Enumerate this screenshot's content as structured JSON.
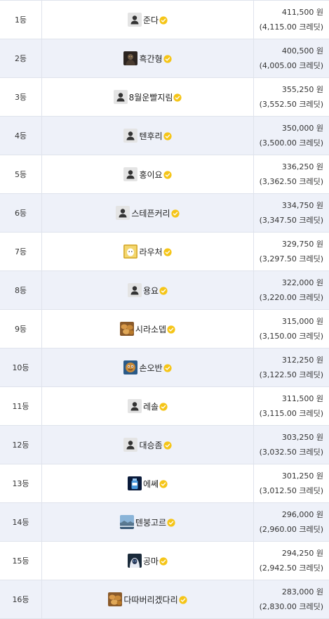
{
  "ranking": [
    {
      "rank": "1등",
      "name": "준다",
      "avatar": "default-user-icon",
      "amount": "411,500 원",
      "credits": "(4,115.00 크레딧)"
    },
    {
      "rank": "2등",
      "name": "흑간형",
      "avatar": "dark-character-avatar",
      "amount": "400,500 원",
      "credits": "(4,005.00 크레딧)"
    },
    {
      "rank": "3등",
      "name": "8월운빨지림",
      "avatar": "default-user-icon",
      "amount": "355,250 원",
      "credits": "(3,552.50 크레딧)"
    },
    {
      "rank": "4등",
      "name": "텐후리",
      "avatar": "default-user-icon",
      "amount": "350,000 원",
      "credits": "(3,500.00 크레딧)"
    },
    {
      "rank": "5등",
      "name": "홍이요",
      "avatar": "default-user-icon",
      "amount": "336,250 원",
      "credits": "(3,362.50 크레딧)"
    },
    {
      "rank": "6등",
      "name": "스테픈커리",
      "avatar": "default-user-icon",
      "amount": "334,750 원",
      "credits": "(3,347.50 크레딧)"
    },
    {
      "rank": "7등",
      "name": "라우처",
      "avatar": "yellow-ghost-avatar",
      "amount": "329,750 원",
      "credits": "(3,297.50 크레딧)"
    },
    {
      "rank": "8등",
      "name": "용요",
      "avatar": "default-user-icon",
      "amount": "322,000 원",
      "credits": "(3,220.00 크레딧)"
    },
    {
      "rank": "9등",
      "name": "시라소뎁",
      "avatar": "bread-avatar",
      "amount": "315,000 원",
      "credits": "(3,150.00 크레딧)"
    },
    {
      "rank": "10등",
      "name": "손오반",
      "avatar": "cookie-face-avatar",
      "amount": "312,250 원",
      "credits": "(3,122.50 크레딧)"
    },
    {
      "rank": "11등",
      "name": "레솔",
      "avatar": "default-user-icon",
      "amount": "311,500 원",
      "credits": "(3,115.00 크레딧)"
    },
    {
      "rank": "12등",
      "name": "대승좀",
      "avatar": "default-user-icon",
      "amount": "303,250 원",
      "credits": "(3,032.50 크레딧)"
    },
    {
      "rank": "13등",
      "name": "에쎄",
      "avatar": "blue-bottle-avatar",
      "amount": "301,250 원",
      "credits": "(3,012.50 크레딧)"
    },
    {
      "rank": "14등",
      "name": "텐붕고르",
      "avatar": "landscape-avatar",
      "amount": "296,000 원",
      "credits": "(2,960.00 크레딧)"
    },
    {
      "rank": "15등",
      "name": "공마",
      "avatar": "hooded-character-avatar",
      "amount": "294,250 원",
      "credits": "(2,942.50 크레딧)"
    },
    {
      "rank": "16등",
      "name": "다따버리겠다리",
      "avatar": "bread-avatar",
      "amount": "283,000 원",
      "credits": "(2,830.00 크레딧)"
    }
  ],
  "colors": {
    "row_alt": "#eef1f9",
    "row_white": "#ffffff",
    "border": "#dfe3ec",
    "verified_badge": "#f5c518"
  }
}
